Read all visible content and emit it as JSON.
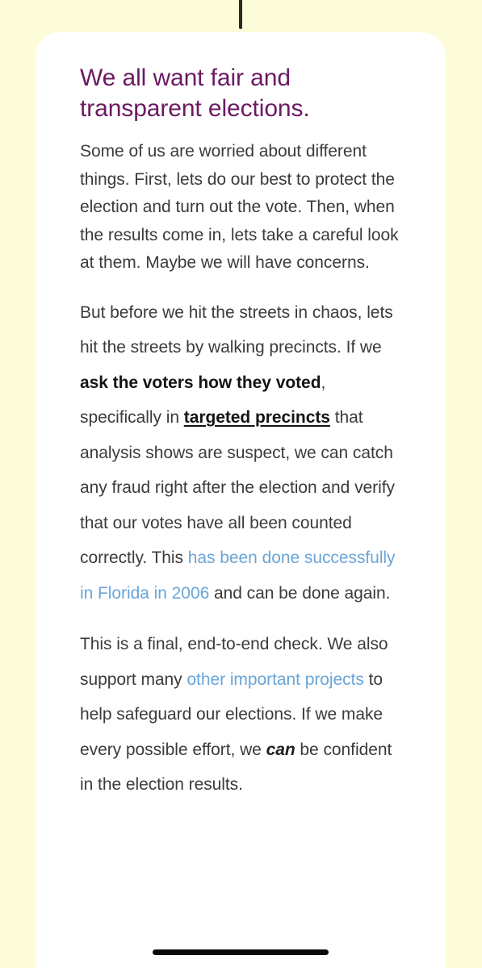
{
  "device": {
    "notch_name": "camera-notch",
    "home_indicator_name": "home-indicator",
    "background_color": "#fdfcd8",
    "card_color": "#ffffff"
  },
  "colors": {
    "heading": "#6b1a63",
    "body_text": "#3b3b3b",
    "link": "#6aa5d7",
    "emphasis": "#141414",
    "page_background": "#fdfcd8"
  },
  "article": {
    "title": "We all want fair and transparent elections.",
    "paragraphs": {
      "intro": "Some of us are worried about different things. First, lets do our best to protect the election and turn out the vote. Then, when the results come in, lets take a careful look at them. Maybe we will have concerns.",
      "precincts": {
        "seg1": "But before we hit the streets in chaos, lets hit the streets by walking precincts. If we ",
        "bold1": "ask the voters how they voted",
        "seg2": ", specifically in ",
        "bold_underline1": "targeted precincts",
        "seg3": " that analysis shows are suspect, we can catch any fraud right after the election and verify that our votes have all been counted correctly. This ",
        "link1": "has been done successfully in Florida in 2006",
        "seg4": " and can be done again."
      },
      "endtoend": {
        "seg1": "This is a final, end-to-end check. We also support many ",
        "link1": "other important projects",
        "seg2": " to help safeguard our elections. If we make every possible effort, we ",
        "em1": "can",
        "seg3": " be confident in the election results."
      }
    }
  }
}
